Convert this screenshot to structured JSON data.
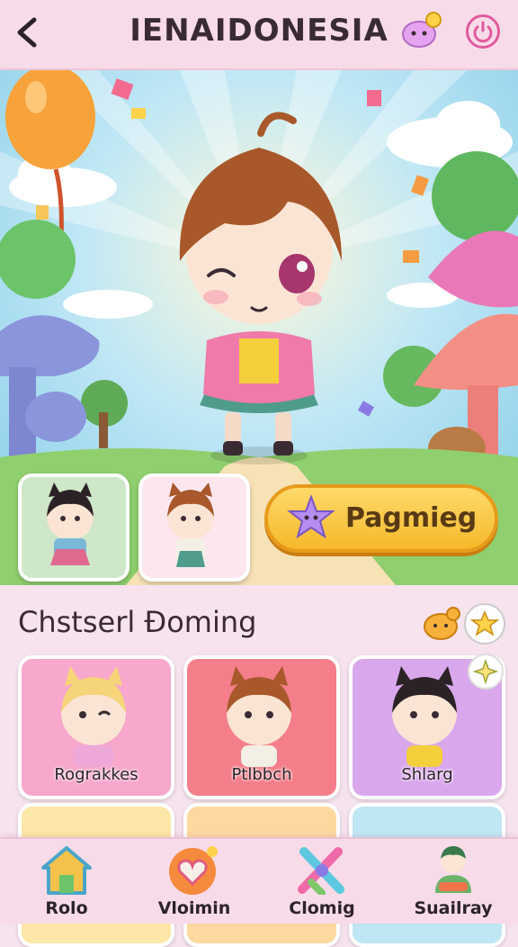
{
  "header": {
    "title": "IENAIDONESIA"
  },
  "hero": {
    "play_button_label": "Pagmieg",
    "thumbnails": [
      "girl-character-thumbnail",
      "boy-character-thumbnail"
    ]
  },
  "section": {
    "title": "Chstserl Đoming",
    "cards": [
      {
        "label": "Rograkkes",
        "bg": "#f7a8cc"
      },
      {
        "label": "Ptlbbch",
        "bg": "#f47f8a"
      },
      {
        "label": "Shlarg",
        "bg": "#d9a8ec"
      }
    ],
    "partial_cards_bg": [
      "#fde7a8",
      "#fdd9a0",
      "#bfe6f3"
    ]
  },
  "nav": {
    "items": [
      {
        "label": "Rolo",
        "icon": "home-icon"
      },
      {
        "label": "Vloimin",
        "icon": "heart-icon"
      },
      {
        "label": "Clomig",
        "icon": "wand-icon"
      },
      {
        "label": "Suailray",
        "icon": "friends-icon"
      }
    ]
  },
  "colors": {
    "accent": "#e05a9e",
    "button": "#f5b92b",
    "header_bg": "#f8dbe9"
  }
}
